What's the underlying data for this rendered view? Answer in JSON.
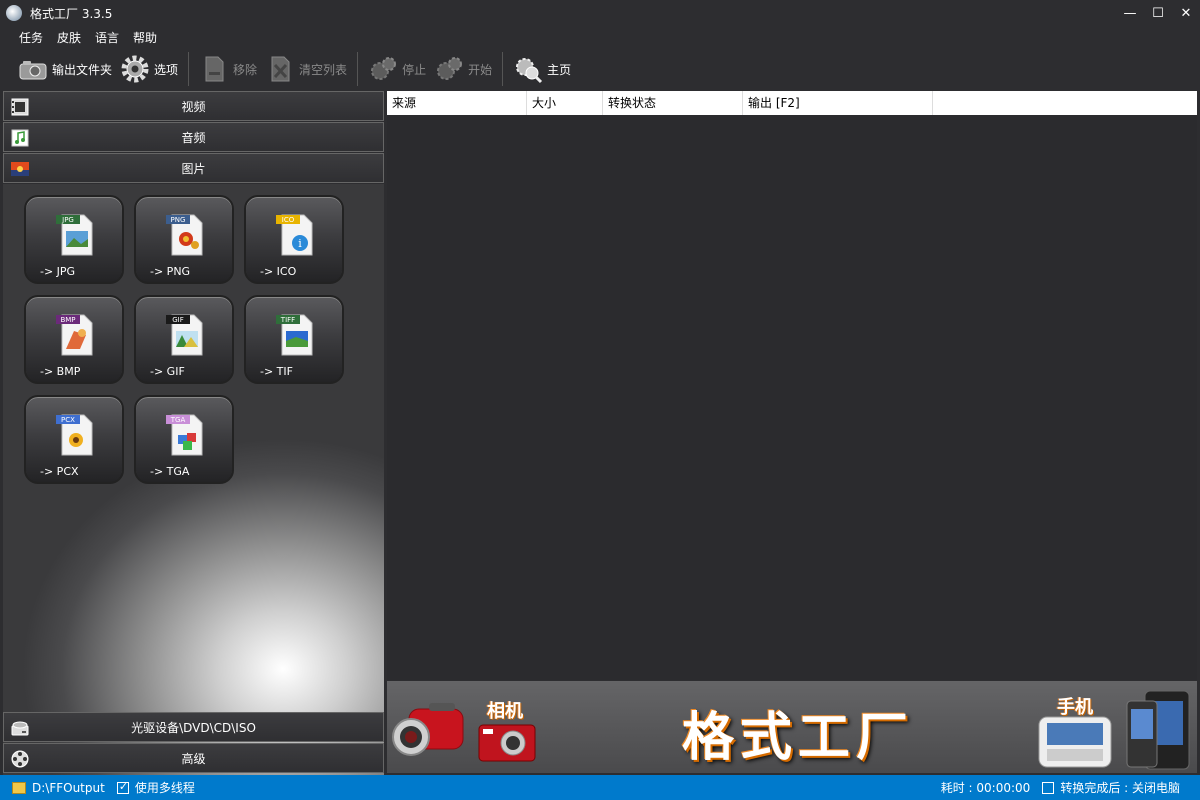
{
  "window": {
    "title": "格式工厂 3.3.5",
    "minimize": "—",
    "maximize": "☐",
    "close": "✕"
  },
  "menu": [
    "任务",
    "皮肤",
    "语言",
    "帮助"
  ],
  "toolbar": {
    "output_folder": "输出文件夹",
    "options": "选项",
    "remove": "移除",
    "clear_list": "清空列表",
    "stop": "停止",
    "start": "开始",
    "home": "主页"
  },
  "categories": {
    "video": "视频",
    "audio": "音频",
    "image": "图片",
    "optical": "光驱设备\\DVD\\CD\\ISO",
    "advanced": "高级"
  },
  "tiles": [
    {
      "badge": "JPG",
      "badge_color": "#2f6e3a",
      "label": "-> JPG"
    },
    {
      "badge": "PNG",
      "badge_color": "#3c5e8e",
      "label": "-> PNG"
    },
    {
      "badge": "ICO",
      "badge_color": "#e8b400",
      "label": "-> ICO"
    },
    {
      "badge": "BMP",
      "badge_color": "#6b2a7a",
      "label": "-> BMP"
    },
    {
      "badge": "GIF",
      "badge_color": "#1a1a1a",
      "label": "-> GIF"
    },
    {
      "badge": "TIFF",
      "badge_color": "#2f6e3a",
      "label": "-> TIF"
    },
    {
      "badge": "PCX",
      "badge_color": "#3f6fd0",
      "label": "-> PCX"
    },
    {
      "badge": "TGA",
      "badge_color": "#c98fd8",
      "label": "-> TGA"
    }
  ],
  "list": {
    "columns": [
      "来源",
      "大小",
      "转换状态",
      "输出 [F2]"
    ]
  },
  "banner": {
    "title": "格式工厂",
    "camera": "相机",
    "phone": "手机"
  },
  "status": {
    "output_path": "D:\\FFOutput",
    "multithread": "使用多线程",
    "elapsed": "耗时 : 00:00:00",
    "after_convert": "转换完成后 : 关闭电脑"
  }
}
